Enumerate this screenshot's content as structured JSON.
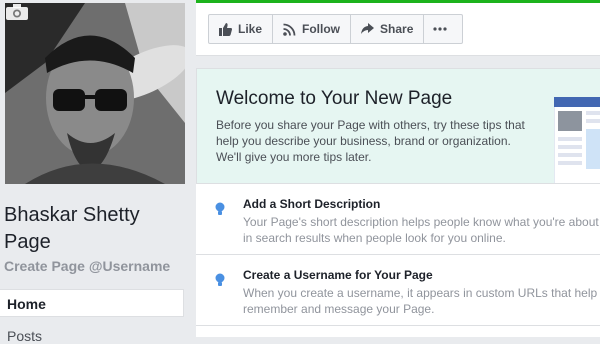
{
  "profile": {
    "name": "Bhaskar Shetty Page",
    "username_link": "Create Page @Username"
  },
  "nav": {
    "home": "Home",
    "posts": "Posts"
  },
  "actions": {
    "like": "Like",
    "follow": "Follow",
    "share": "Share"
  },
  "welcome": {
    "title": "Welcome to Your New Page",
    "body": "Before you share your Page with others, try these tips that help you describe your business, brand or organization. We'll give you more tips later."
  },
  "tips": [
    {
      "title": "Add a Short Description",
      "body_line1": "Your Page's short description helps people know what you're about",
      "body_line2": "in search results when people look for you online."
    },
    {
      "title": "Create a Username for Your Page",
      "body_line1": "When you create a username, it appears in custom URLs that help",
      "body_line2": "remember and message your Page."
    }
  ],
  "colors": {
    "accent_green": "#1db31d",
    "welcome_bg": "#e6f6f2",
    "tip_icon": "#4a90e2"
  }
}
